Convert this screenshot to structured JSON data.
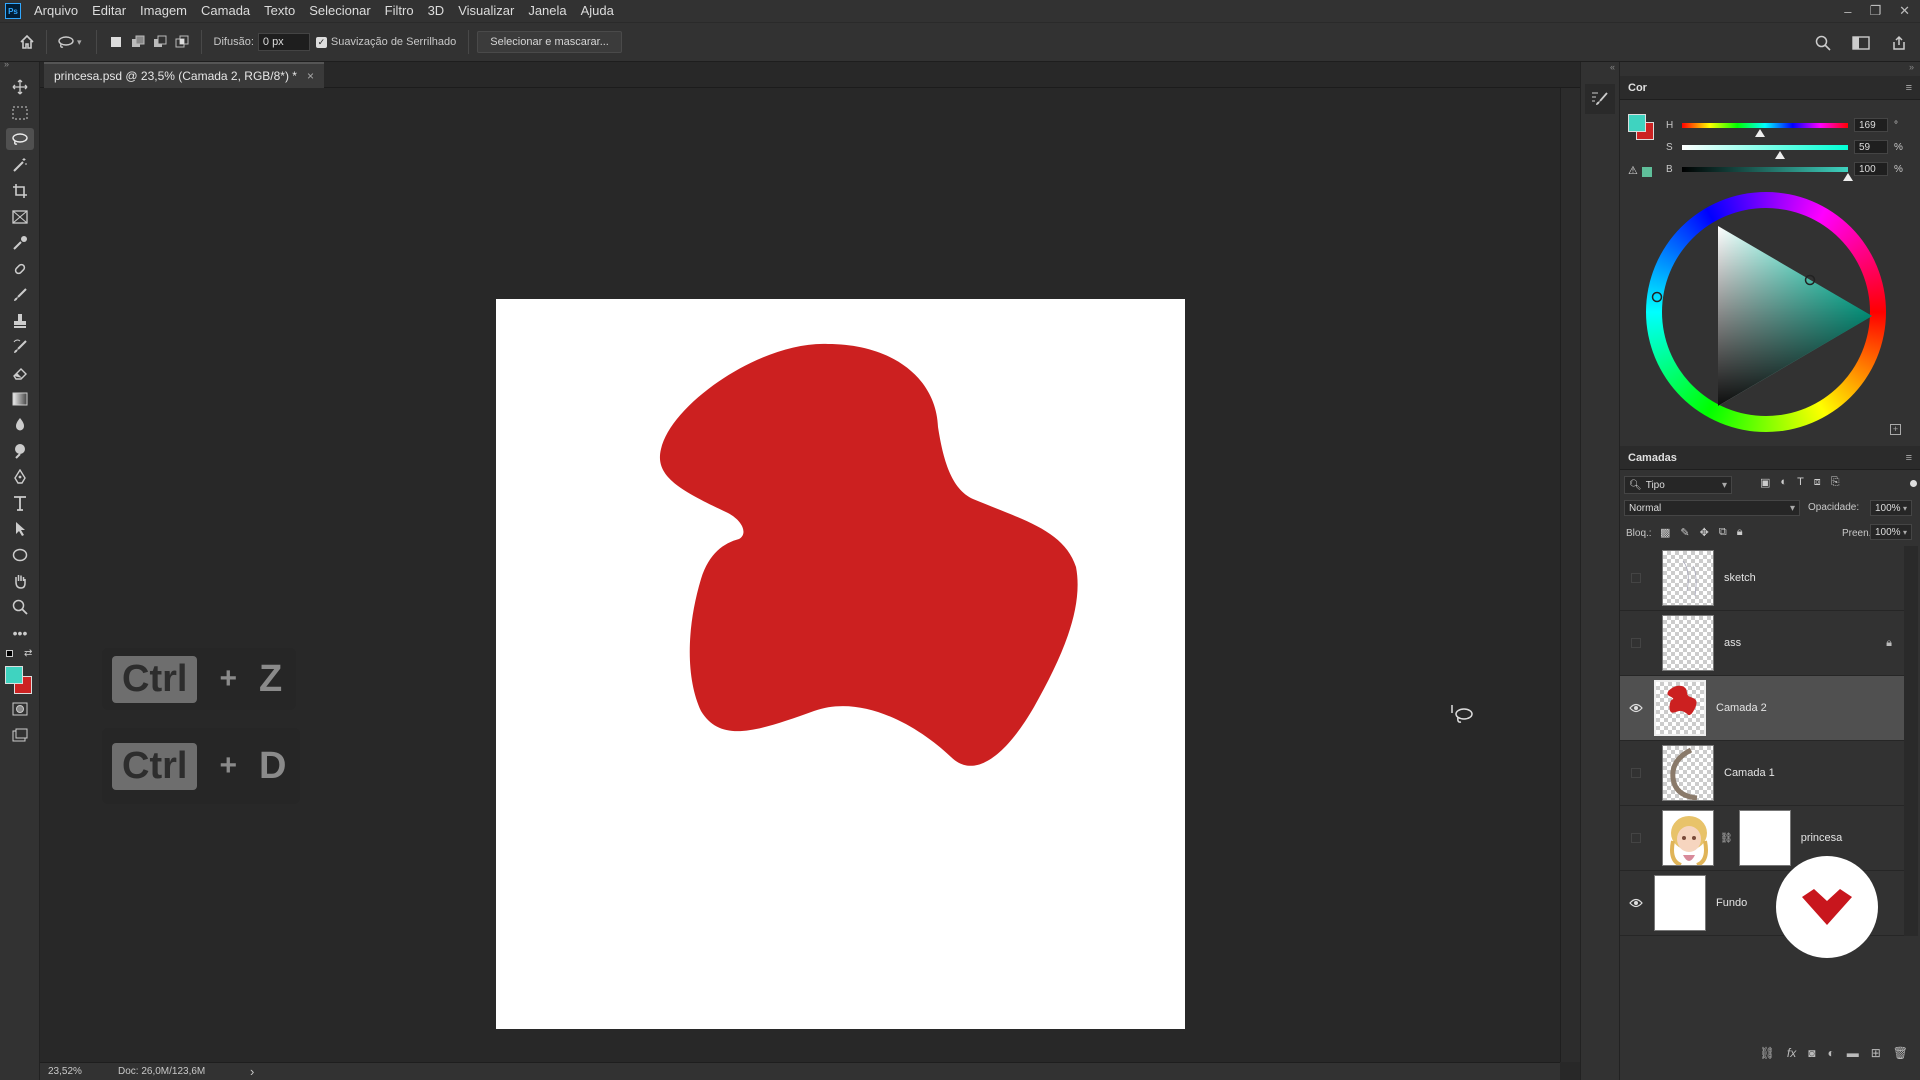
{
  "menubar": {
    "app_logo": "Ps",
    "items": [
      "Arquivo",
      "Editar",
      "Imagem",
      "Camada",
      "Texto",
      "Selecionar",
      "Filtro",
      "3D",
      "Visualizar",
      "Janela",
      "Ajuda"
    ]
  },
  "options": {
    "feather_label": "Difusão:",
    "feather_value": "0 px",
    "antialias_label": "Suavização de Serrilhado",
    "antialias_checked": true,
    "select_mask_label": "Selecionar e mascarar..."
  },
  "document": {
    "tab_title": "princesa.psd @ 23,5% (Camada 2, RGB/8*) *",
    "close_glyph": "×"
  },
  "shortcuts": [
    {
      "key": "Ctrl",
      "plus": "+",
      "letter": "Z"
    },
    {
      "key": "Ctrl",
      "plus": "+",
      "letter": "D"
    }
  ],
  "status": {
    "zoom": "23,52%",
    "doc_size": "Doc: 26,0M/123,6M",
    "arrow": "›"
  },
  "color_panel": {
    "title": "Cor",
    "foreground": "#3fd3c0",
    "background": "#cc2222",
    "h_label": "H",
    "h_value": "169",
    "h_unit": "°",
    "h_fraction": 0.47,
    "s_label": "S",
    "s_value": "59",
    "s_unit": "%",
    "s_fraction": 0.59,
    "b_label": "B",
    "b_value": "100",
    "b_unit": "%",
    "b_fraction": 1.0
  },
  "layers_panel": {
    "title": "Camadas",
    "filter_label": "Tipo",
    "blend_mode": "Normal",
    "opacity_label": "Opacidade:",
    "opacity_value": "100%",
    "lock_label": "Bloq.:",
    "fill_label": "Preen.:",
    "fill_value": "100%",
    "layers": [
      {
        "name": "sketch",
        "visible": false,
        "locked": false,
        "selected": false
      },
      {
        "name": "ass",
        "visible": false,
        "locked": true,
        "selected": false
      },
      {
        "name": "Camada 2",
        "visible": true,
        "locked": false,
        "selected": true
      },
      {
        "name": "Camada 1",
        "visible": false,
        "locked": false,
        "selected": false
      },
      {
        "name": "princesa",
        "visible": false,
        "locked": false,
        "selected": false,
        "has_mask": true
      },
      {
        "name": "Fundo",
        "visible": true,
        "locked": false,
        "selected": false
      }
    ]
  },
  "colors": {
    "shape_red": "#cc2020",
    "panel_bg": "#323232",
    "workspace_bg": "#282828",
    "logo_red": "#c8161d"
  }
}
